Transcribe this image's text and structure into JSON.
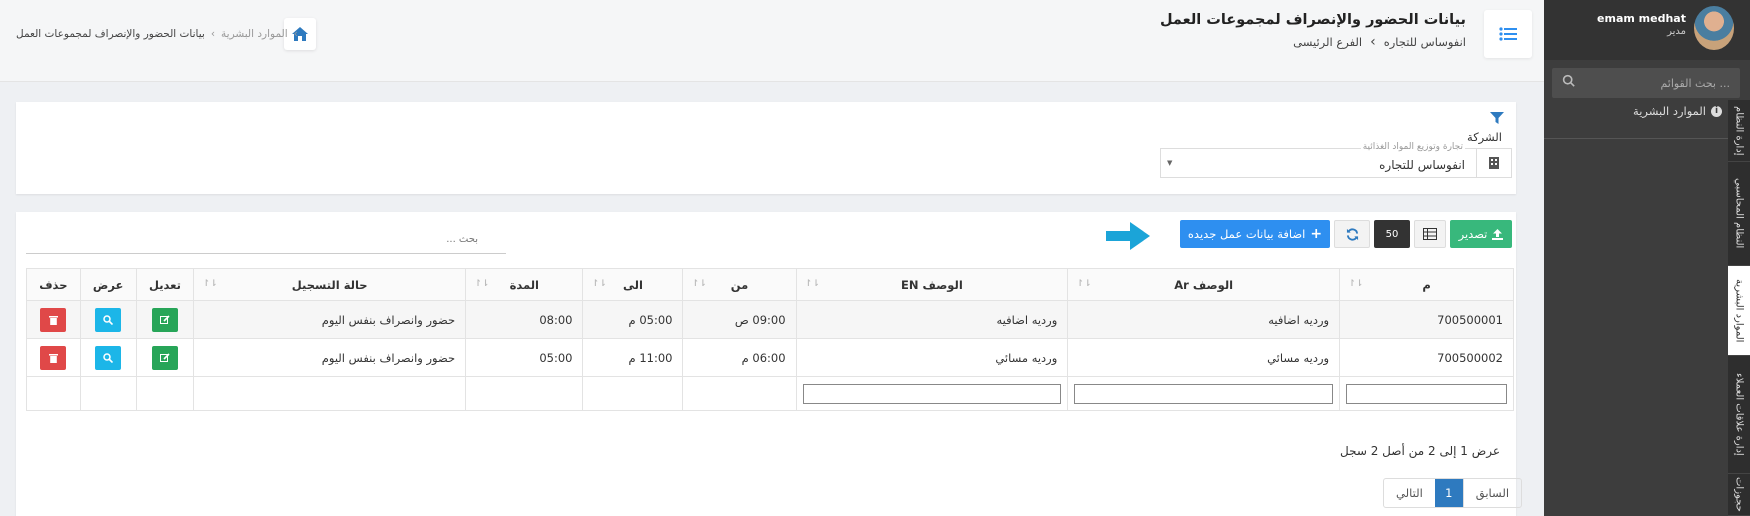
{
  "header": {
    "title": "بيانات الحضور والإنصراف لمجموعات العمل",
    "company": "انفوساس للتجاره",
    "branch": "الفرع الرئيسى",
    "breadcrumb": {
      "section": "الموارد البشرية",
      "current": "بيانات الحضور والإنصراف لمجموعات العمل"
    }
  },
  "sidebar": {
    "user_name": "emam medhat",
    "user_role": "مدير",
    "search_placeholder": "بحث القوائم ...",
    "menu_item": "الموارد البشرية",
    "tabs": [
      "إدارة النظام",
      "النظام المحاسبي",
      "الموارد البشرية",
      "إدارة علاقات العملاء",
      "حجوزات"
    ]
  },
  "filter": {
    "label": "الشركة",
    "field_label": "تجارة وتوزيع المواد الغذائية",
    "value": "انفوساس للتجاره"
  },
  "toolbar": {
    "export_label": "تصدير",
    "page_length": "50",
    "add_label": "اضافة بيانات عمل جديده",
    "search_placeholder": "بحث ..."
  },
  "table": {
    "columns": [
      "م",
      "الوصف Ar",
      "الوصف EN",
      "من",
      "الى",
      "المدة",
      "حالة التسجيل",
      "تعديل",
      "عرض",
      "حذف"
    ],
    "rows": [
      {
        "id": "700500001",
        "desc_ar": "ورديه اضافيه",
        "desc_en": "ورديه اضافيه",
        "from": "09:00 ص",
        "to": "05:00 م",
        "duration": "08:00",
        "status": "حضور وانصراف بنفس اليوم"
      },
      {
        "id": "700500002",
        "desc_ar": "ورديه مسائي",
        "desc_en": "ورديه مسائي",
        "from": "06:00 م",
        "to": "11:00 م",
        "duration": "05:00",
        "status": "حضور وانصراف بنفس اليوم"
      }
    ]
  },
  "pagination": {
    "info": "عرض 1 إلى 2 من أصل 2 سجل",
    "prev": "السابق",
    "current": "1",
    "next": "التالي"
  },
  "colors": {
    "add_button": "#2e8ff0",
    "export_button": "#38b87c",
    "sidebar": "#3d3d3d",
    "arrow": "#1ba4d8"
  }
}
